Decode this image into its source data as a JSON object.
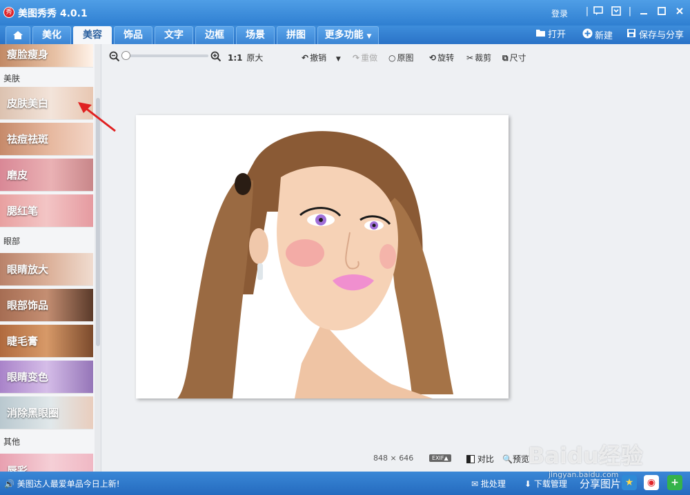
{
  "app": {
    "title": "美图秀秀 4.0.1",
    "icon": "app-logo-icon",
    "login": "登录"
  },
  "tabs": [
    {
      "label": "美化"
    },
    {
      "label": "美容"
    },
    {
      "label": "饰品"
    },
    {
      "label": "文字"
    },
    {
      "label": "边框"
    },
    {
      "label": "场景"
    },
    {
      "label": "拼图"
    },
    {
      "label": "更多功能"
    }
  ],
  "actions": {
    "open": "打开",
    "new": "新建",
    "save_share": "保存与分享"
  },
  "left_panel": {
    "top_item": "瘦脸瘦身",
    "categories": {
      "skin": "美肤",
      "eyes": "眼部",
      "other": "其他"
    },
    "skin_items": [
      "皮肤美白",
      "祛痘祛斑",
      "磨皮",
      "腮红笔"
    ],
    "eye_items": [
      "眼睛放大",
      "眼部饰品",
      "睫毛膏",
      "眼睛变色",
      "消除黑眼圈"
    ],
    "bottom_item": "唇彩"
  },
  "toolbar": {
    "ratio": "1:1",
    "original_size": "原大",
    "undo": "撤销",
    "redo": "重做",
    "original": "原图",
    "rotate": "旋转",
    "crop": "裁剪",
    "size": "尺寸"
  },
  "image": {
    "width": "848",
    "times": "×",
    "height": "646"
  },
  "bottom_tools": {
    "exif": "EXIF▲",
    "compare": "对比",
    "preview": "预览"
  },
  "statusbar": {
    "message": "美图达人最爱单品今日上新!",
    "batch": "批处理",
    "download": "下载管理",
    "share": "分享图片"
  },
  "watermark": {
    "brand": "Baidu经验",
    "url": "jingyan.baidu.com"
  },
  "colors": {
    "accent": "#2f7fd1",
    "annotation_arrow": "#e02020"
  }
}
